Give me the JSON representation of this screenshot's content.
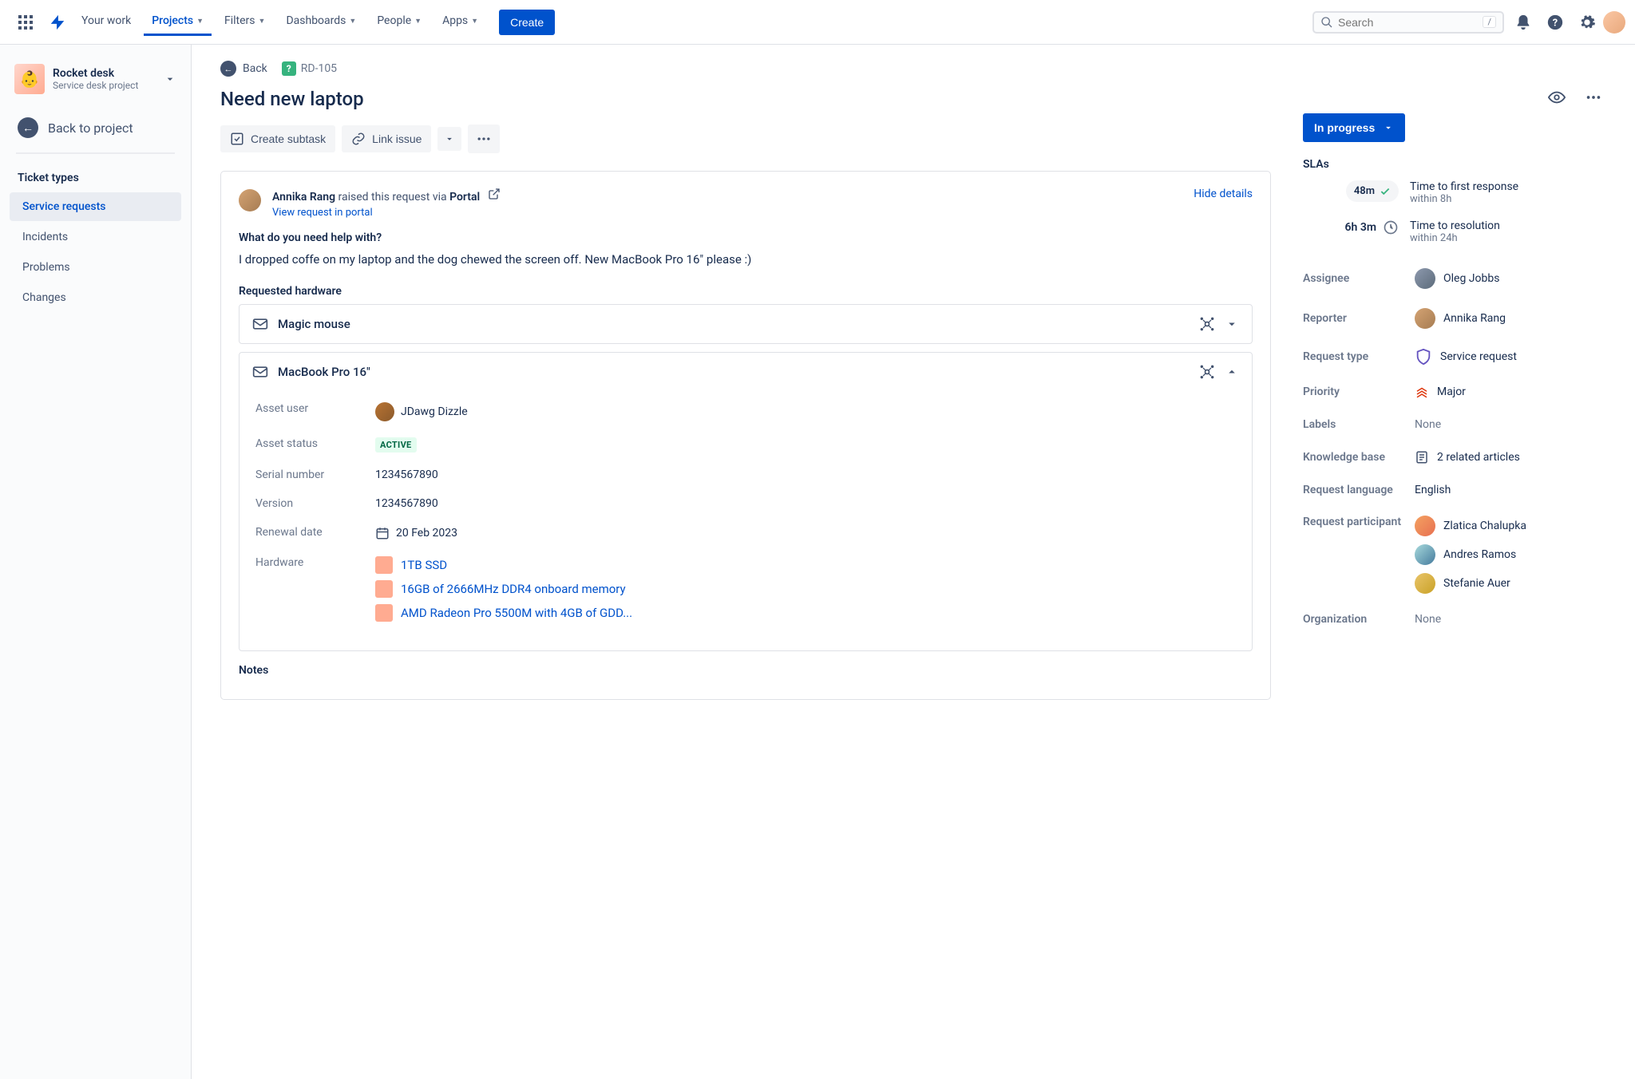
{
  "topnav": {
    "items": [
      "Your work",
      "Projects",
      "Filters",
      "Dashboards",
      "People",
      "Apps"
    ],
    "active": "Projects",
    "create": "Create",
    "search_placeholder": "Search"
  },
  "sidebar": {
    "project_title": "Rocket desk",
    "project_subtitle": "Service desk project",
    "back_label": "Back to project",
    "section": "Ticket types",
    "items": [
      "Service requests",
      "Incidents",
      "Problems",
      "Changes"
    ],
    "selected": "Service requests"
  },
  "breadcrumb": {
    "back": "Back",
    "issue_key": "RD-105"
  },
  "issue": {
    "title": "Need new laptop",
    "actions": {
      "create_subtask": "Create subtask",
      "link_issue": "Link issue"
    },
    "requester": {
      "name": "Annika Rang",
      "via_pre": " raised this request via ",
      "via": "Portal",
      "view_link": "View request in portal",
      "hide_details": "Hide details"
    },
    "help_label": "What do you need help with?",
    "help_body": "I dropped coffe on my laptop and the dog chewed the screen off. New MacBook Pro 16\" please :)",
    "hw_label": "Requested hardware",
    "hardware_items": [
      {
        "name": "Magic mouse",
        "expanded": false
      },
      {
        "name": "MacBook Pro 16\"",
        "expanded": true,
        "details": {
          "asset_user_label": "Asset user",
          "asset_user": "JDawg Dizzle",
          "asset_status_label": "Asset status",
          "asset_status": "ACTIVE",
          "serial_label": "Serial number",
          "serial": "1234567890",
          "version_label": "Version",
          "version": "1234567890",
          "renewal_label": "Renewal date",
          "renewal": "20 Feb 2023",
          "hardware_label": "Hardware",
          "hardware_links": [
            "1TB SSD",
            "16GB of 2666MHz DDR4 onboard memory",
            "AMD Radeon Pro 5500M with 4GB of GDD..."
          ]
        }
      }
    ],
    "notes_label": "Notes"
  },
  "side": {
    "status": "In progress",
    "slas_label": "SLAs",
    "slas": [
      {
        "time": "48m",
        "icon": "check",
        "title": "Time to first response",
        "sub": "within 8h"
      },
      {
        "time": "6h 3m",
        "icon": "clock",
        "title": "Time to resolution",
        "sub": "within 24h"
      }
    ],
    "assignee_label": "Assignee",
    "assignee": "Oleg Jobbs",
    "reporter_label": "Reporter",
    "reporter": "Annika Rang",
    "reqtype_label": "Request type",
    "reqtype": "Service request",
    "priority_label": "Priority",
    "priority": "Major",
    "labels_label": "Labels",
    "labels": "None",
    "kb_label": "Knowledge base",
    "kb": "2 related articles",
    "lang_label": "Request language",
    "lang": "English",
    "participants_label": "Request participant",
    "participants": [
      "Zlatica Chalupka",
      "Andres Ramos",
      "Stefanie Auer"
    ],
    "org_label": "Organization",
    "org": "None"
  }
}
